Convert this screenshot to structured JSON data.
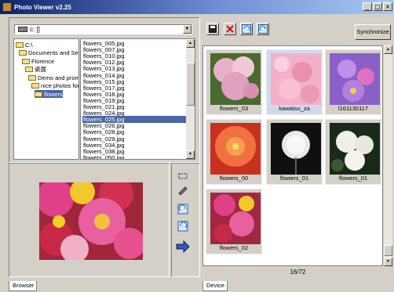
{
  "window": {
    "title": "Photo Viewer v2.25",
    "min": "_",
    "max": "□",
    "close": "×"
  },
  "browser": {
    "drive": "c: []",
    "tree": [
      {
        "label": "C:\\",
        "indent": 0
      },
      {
        "label": "Documents and Setti",
        "indent": 1
      },
      {
        "label": "Florence",
        "indent": 2
      },
      {
        "label": "桌面",
        "indent": 3
      },
      {
        "label": "Demo and promo",
        "indent": 4
      },
      {
        "label": "nice photos for c",
        "indent": 5
      },
      {
        "label": "flowers",
        "indent": 6,
        "selected": true
      }
    ],
    "files": [
      "flowers_005.jpg",
      "flowers_007.jpg",
      "flowers_010.jpg",
      "flowers_012.jpg",
      "flowers_013.jpg",
      "flowers_014.jpg",
      "flowers_015.jpg",
      "flowers_017.jpg",
      "flowers_018.jpg",
      "flowers_019.jpg",
      "flowers_021.jpg",
      "flowers_024.jpg",
      "flowers_025.jpg",
      "flowers_026.jpg",
      "flowers_028.jpg",
      "flowers_029.jpg",
      "flowers_034.jpg",
      "flowers_038.jpg",
      "flowers_050.jpg"
    ],
    "selected_file_index": 12,
    "tab": "Browser"
  },
  "device": {
    "tab": "Device",
    "sync_label": "Synchronize",
    "status": "16/72",
    "thumbs": [
      {
        "caption": "flowers_03"
      },
      {
        "caption": "kawatsu_za"
      },
      {
        "caption": "l161130117"
      },
      {
        "caption": "flowers_00"
      },
      {
        "caption": "flowers_01"
      },
      {
        "caption": "flowers_01"
      },
      {
        "caption": "flowers_02"
      }
    ]
  },
  "colors": {
    "accent": "#0a246a",
    "selection": "#4a66a8",
    "delete": "#cc1111"
  }
}
